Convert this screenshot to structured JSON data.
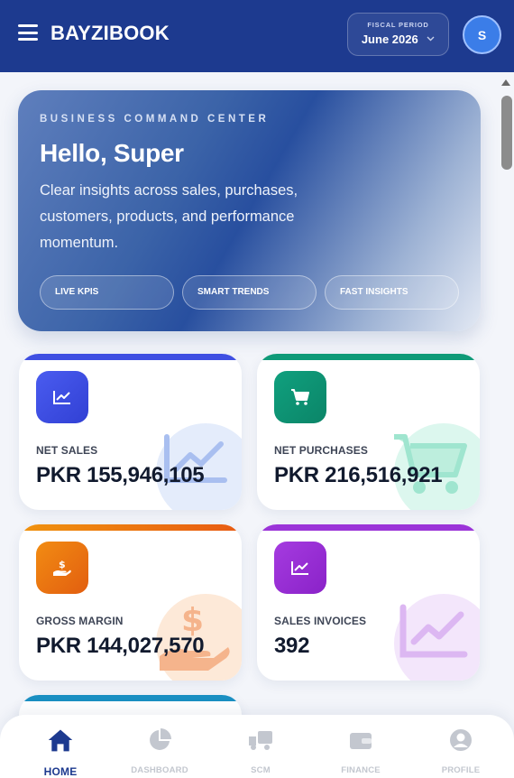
{
  "header": {
    "brand": "BAYZIBOOK",
    "fiscal_period_label": "FISCAL PERIOD",
    "fiscal_period_value": "June 2026",
    "avatar_initial": "S"
  },
  "hero": {
    "eyebrow": "BUSINESS COMMAND CENTER",
    "greeting": "Hello, Super",
    "description": "Clear insights across sales, purchases, customers, products, and performance momentum.",
    "chips": [
      "LIVE KPIS",
      "SMART TRENDS",
      "FAST INSIGHTS"
    ]
  },
  "cards": [
    {
      "label": "NET SALES",
      "value": "PKR 155,946,105",
      "icon": "trending-up-icon",
      "color": "#3b4ce0"
    },
    {
      "label": "NET PURCHASES",
      "value": "PKR 216,516,921",
      "icon": "cart-icon",
      "color": "#0e9576"
    },
    {
      "label": "GROSS MARGIN",
      "value": "PKR 144,027,570",
      "icon": "hand-dollar-icon",
      "color": "#ea6a10"
    },
    {
      "label": "SALES INVOICES",
      "value": "392",
      "icon": "trending-up-icon",
      "color": "#9b2fd6"
    }
  ],
  "bottom_nav": [
    {
      "label": "HOME",
      "icon": "home-icon",
      "active": true
    },
    {
      "label": "DASHBOARD",
      "icon": "pie-chart-icon",
      "active": false
    },
    {
      "label": "SCM",
      "icon": "truck-icon",
      "active": false
    },
    {
      "label": "FINANCE",
      "icon": "wallet-icon",
      "active": false
    },
    {
      "label": "PROFILE",
      "icon": "user-icon",
      "active": false
    }
  ]
}
